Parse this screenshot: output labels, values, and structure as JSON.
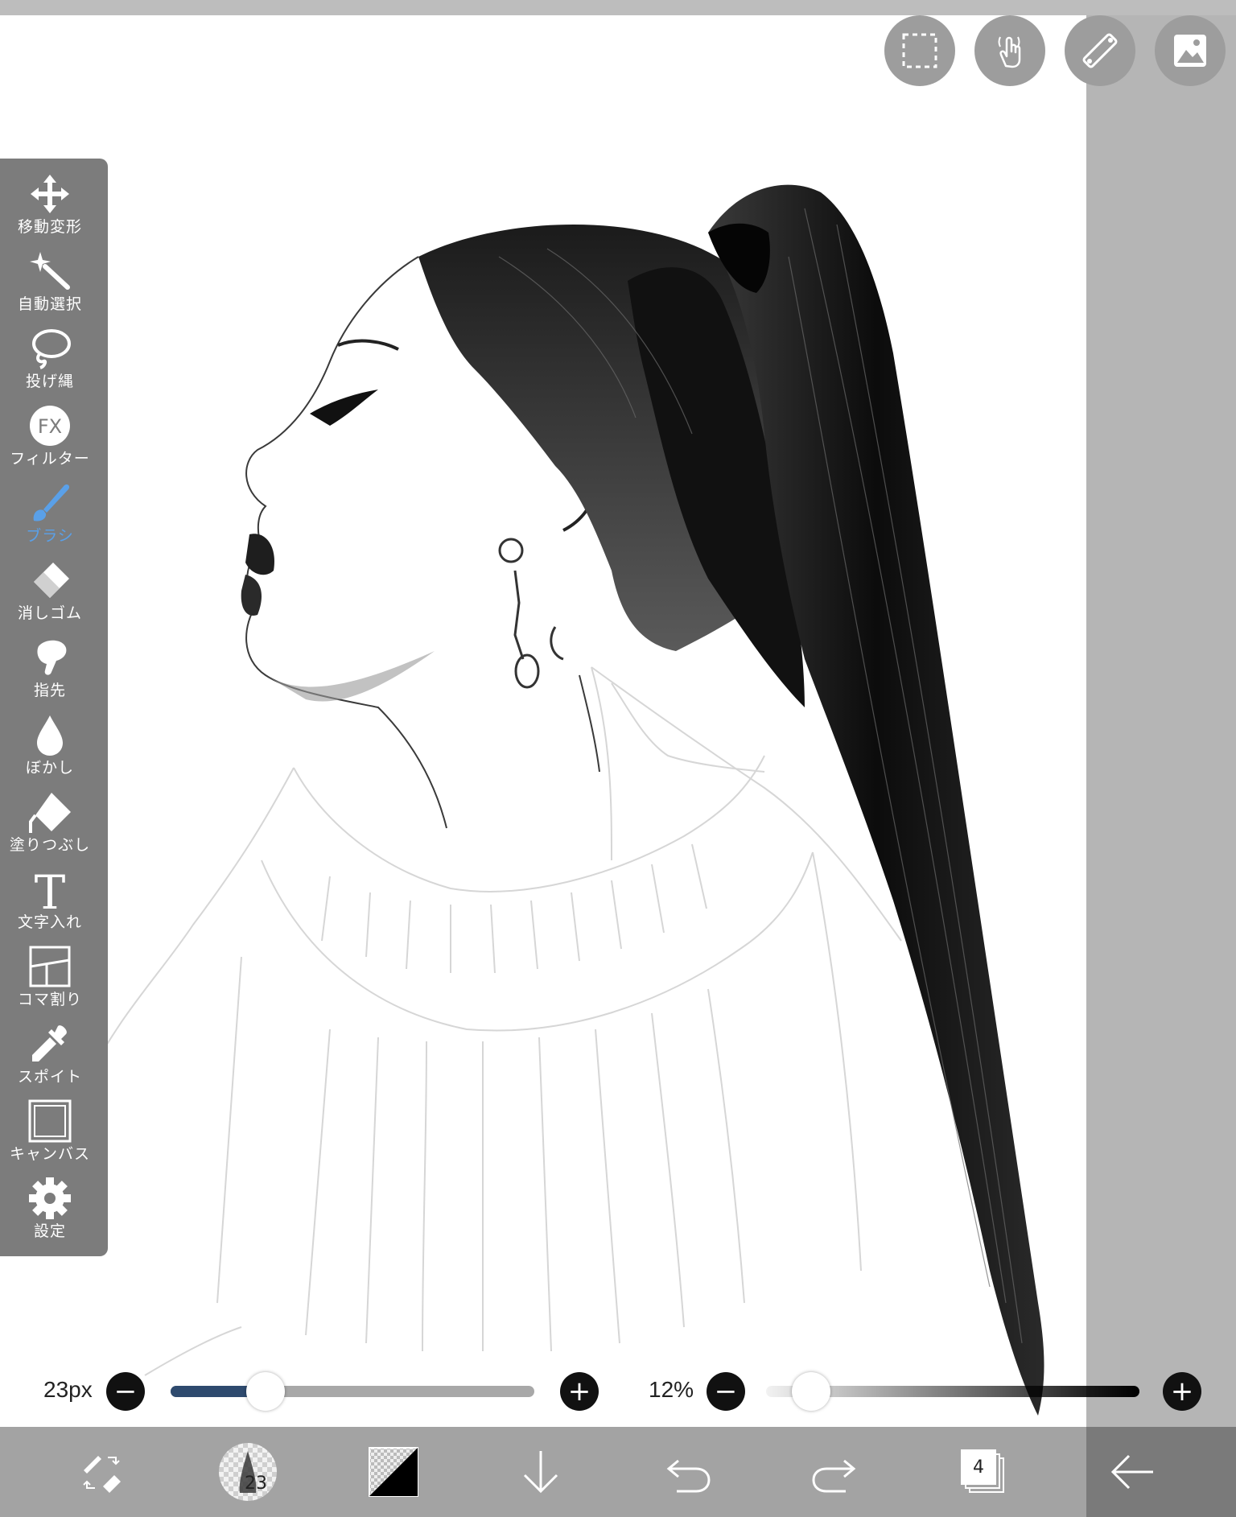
{
  "top_buttons": [
    {
      "name": "selection-icon"
    },
    {
      "name": "touch-gesture-icon"
    },
    {
      "name": "ruler-icon"
    },
    {
      "name": "material-image-icon"
    }
  ],
  "tools": [
    {
      "label": "移動変形",
      "icon": "move-transform-icon"
    },
    {
      "label": "自動選択",
      "icon": "magic-wand-icon"
    },
    {
      "label": "投げ縄",
      "icon": "lasso-icon"
    },
    {
      "label": "フィルター",
      "icon": "filter-fx-icon",
      "fx_text": "FX"
    },
    {
      "label": "ブラシ",
      "icon": "brush-icon",
      "active": true
    },
    {
      "label": "消しゴム",
      "icon": "eraser-icon"
    },
    {
      "label": "指先",
      "icon": "finger-smudge-icon"
    },
    {
      "label": "ぼかし",
      "icon": "blur-drop-icon"
    },
    {
      "label": "塗りつぶし",
      "icon": "fill-bucket-icon"
    },
    {
      "label": "文字入れ",
      "icon": "text-icon",
      "text_glyph": "T"
    },
    {
      "label": "コマ割り",
      "icon": "frame-divider-icon"
    },
    {
      "label": "スポイト",
      "icon": "eyedropper-icon"
    },
    {
      "label": "キャンバス",
      "icon": "canvas-icon"
    },
    {
      "label": "設定",
      "icon": "settings-gear-icon"
    }
  ],
  "brush_size": {
    "value_label": "23px",
    "minus": "−",
    "plus": "+",
    "level": 0.26
  },
  "opacity": {
    "value_label": "12%",
    "minus": "−",
    "plus": "+",
    "level": 0.12
  },
  "bottom_bar": {
    "brush_preview_size": "23",
    "layer_count": "4"
  },
  "colors": {
    "accent": "#5aa0e8",
    "slider_fill": "#2e4a6e"
  }
}
